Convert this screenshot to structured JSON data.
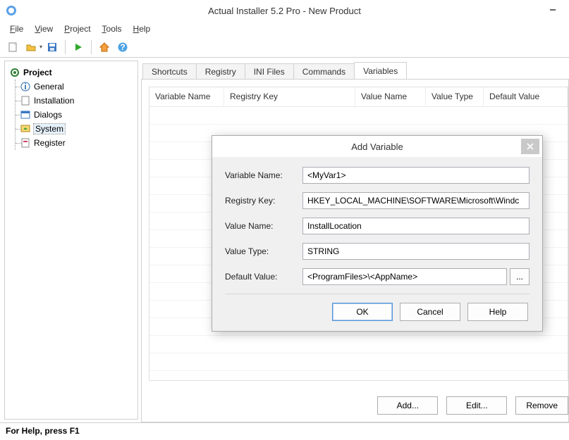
{
  "window": {
    "title": "Actual Installer 5.2 Pro - New Product"
  },
  "menu": {
    "file": "File",
    "view": "View",
    "project": "Project",
    "tools": "Tools",
    "help": "Help"
  },
  "tree": {
    "root": "Project",
    "items": [
      {
        "label": "General"
      },
      {
        "label": "Installation"
      },
      {
        "label": "Dialogs"
      },
      {
        "label": "System",
        "selected": true
      },
      {
        "label": "Register"
      }
    ]
  },
  "tabs": {
    "items": [
      "Shortcuts",
      "Registry",
      "INI Files",
      "Commands",
      "Variables"
    ],
    "active": "Variables"
  },
  "grid": {
    "columns": [
      "Variable Name",
      "Registry Key",
      "Value Name",
      "Value Type",
      "Default Value"
    ]
  },
  "buttons": {
    "add": "Add...",
    "edit": "Edit...",
    "remove": "Remove"
  },
  "statusbar": "For Help, press F1",
  "dialog": {
    "title": "Add Variable",
    "labels": {
      "variable_name": "Variable Name:",
      "registry_key": "Registry Key:",
      "value_name": "Value Name:",
      "value_type": "Value Type:",
      "default_value": "Default Value:"
    },
    "values": {
      "variable_name": "<MyVar1>",
      "registry_key": "HKEY_LOCAL_MACHINE\\SOFTWARE\\Microsoft\\Windc",
      "value_name": "InstallLocation",
      "value_type": "STRING",
      "default_value": "<ProgramFiles>\\<AppName>"
    },
    "browse": "...",
    "buttons": {
      "ok": "OK",
      "cancel": "Cancel",
      "help": "Help"
    }
  }
}
